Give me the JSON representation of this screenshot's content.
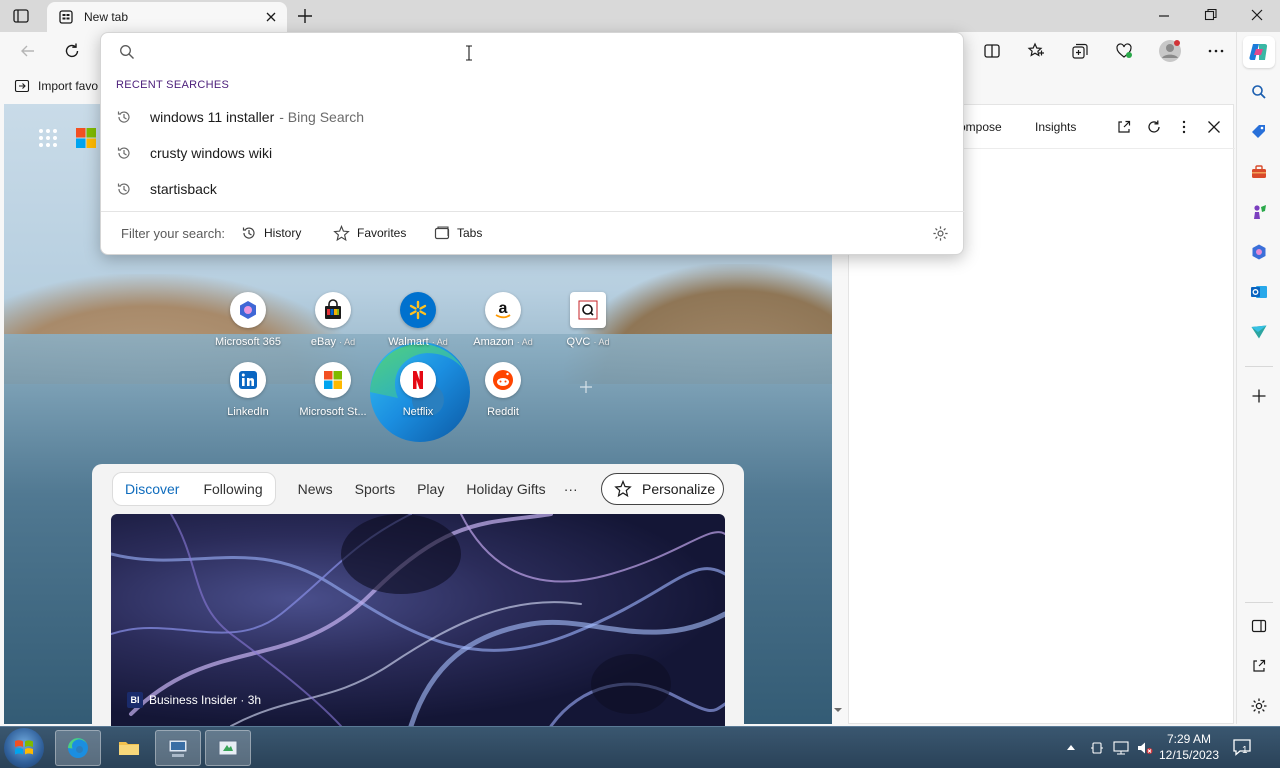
{
  "browser": {
    "tab_title": "New tab",
    "favorites_bar": {
      "import_label": "Import favo"
    }
  },
  "omnibox": {
    "recent_header": "RECENT SEARCHES",
    "recent": [
      {
        "query": "windows 11 installer",
        "suffix": "- Bing Search"
      },
      {
        "query": "crusty windows wiki",
        "suffix": ""
      },
      {
        "query": "startisback",
        "suffix": ""
      }
    ],
    "filter_label": "Filter your search:",
    "filters": [
      "History",
      "Favorites",
      "Tabs"
    ]
  },
  "quick_links": [
    {
      "label": "Microsoft 365",
      "ad": "",
      "icon": "m365-icon"
    },
    {
      "label": "eBay",
      "ad": "· Ad",
      "icon": "ebay-icon"
    },
    {
      "label": "Walmart",
      "ad": "· Ad",
      "icon": "walmart-icon"
    },
    {
      "label": "Amazon",
      "ad": "· Ad",
      "icon": "amazon-icon"
    },
    {
      "label": "QVC",
      "ad": "· Ad",
      "icon": "qvc-icon"
    },
    {
      "label": "LinkedIn",
      "ad": "",
      "icon": "linkedin-icon"
    },
    {
      "label": "Microsoft St...",
      "ad": "",
      "icon": "microsoft-store-icon"
    },
    {
      "label": "Netflix",
      "ad": "",
      "icon": "netflix-icon"
    },
    {
      "label": "Reddit",
      "ad": "",
      "icon": "reddit-icon"
    }
  ],
  "feed": {
    "tabs": [
      "Discover",
      "Following"
    ],
    "tabs2": [
      "News",
      "Sports",
      "Play",
      "Holiday Gifts"
    ],
    "more": "···",
    "personalize": "Personalize",
    "source": "Business Insider · 3h",
    "source_badge": "BI"
  },
  "copilot_pane": {
    "compose_label": "ompose",
    "insights_label": "Insights"
  },
  "taskbar": {
    "time": "7:29 AM",
    "date": "12/15/2023",
    "notif_count": "1"
  },
  "colors": {
    "accent": "#0f6cbd",
    "recent_header": "#4b1d7a",
    "taskbar": "#2a4258"
  }
}
